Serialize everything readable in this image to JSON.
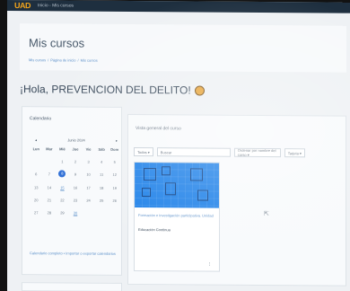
{
  "topbar": {
    "logo": "UAD",
    "title": "Inicio - Mis cursos"
  },
  "header": {
    "title": "Mis cursos",
    "breadcrumb": [
      "Mis cursos",
      "Página de inicio",
      "Mis cursos"
    ]
  },
  "greeting": {
    "text": "¡Hola, PREVENCION DEL DELITO!"
  },
  "calendar": {
    "heading": "Calendario",
    "month": "Junio 2024",
    "prev": "◂",
    "next": "▸",
    "weekdays": [
      "Lun",
      "Mar",
      "Mié",
      "Jue",
      "Vie",
      "Sáb",
      "Dom"
    ],
    "footer": "Calendario completo • Importar o exportar calendarios"
  },
  "overview": {
    "heading": "Vista general del curso",
    "filter": "Todos ▾",
    "search_placeholder": "Buscar",
    "sort": "Ordenar por nombre del curso ▾",
    "view": "Tarjeta ▾",
    "course": {
      "category": "Formación e investigación participativa. Unidad",
      "name": "Educación Continua",
      "menu": "⋮"
    }
  },
  "colors": {
    "accent": "#2f6fd6",
    "course_image": "#1b7fe8",
    "link": "#5a8fc9"
  }
}
